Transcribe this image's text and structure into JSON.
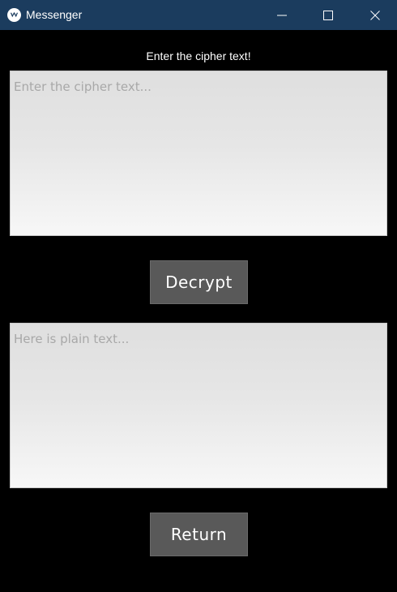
{
  "window": {
    "title": "Messenger",
    "icon": "kivy-logo-icon",
    "controls": [
      "minimize-icon",
      "maximize-icon",
      "close-icon"
    ],
    "titlebar_color": "#1b3c5e",
    "background_color": "#000000"
  },
  "main": {
    "prompt": "Enter the cipher text!",
    "cipher_input": {
      "placeholder": "Enter the cipher text...",
      "value": ""
    },
    "decrypt_label": "Decrypt",
    "plain_output": {
      "placeholder": "Here is plain text...",
      "value": ""
    },
    "return_label": "Return",
    "button_color": "#595959"
  }
}
